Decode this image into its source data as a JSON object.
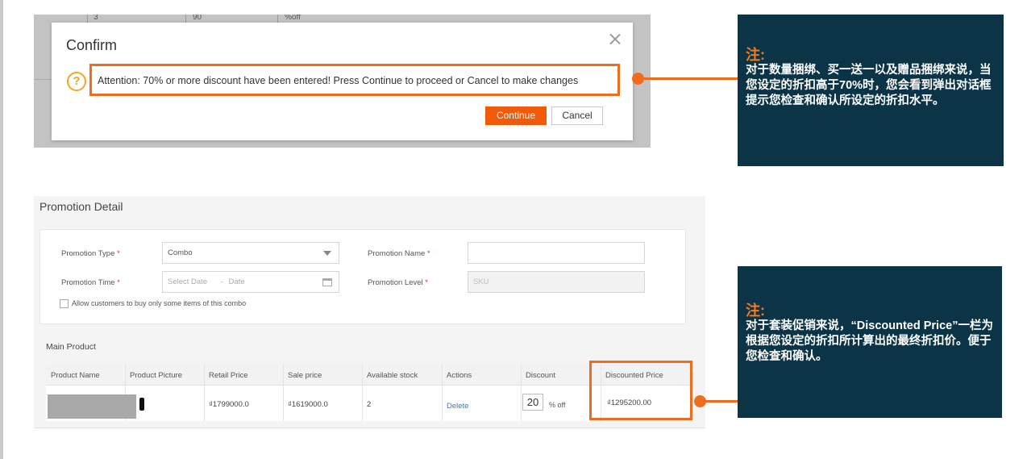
{
  "confirm_shot": {
    "background_row": {
      "qty": "3",
      "value": "90",
      "unit": "%off"
    },
    "dialog": {
      "title": "Confirm",
      "message": "Attention: 70% or more discount have been entered! Press Continue to proceed or Cancel to make changes",
      "warning_glyph": "?",
      "continue_label": "Continue",
      "cancel_label": "Cancel"
    }
  },
  "note1": {
    "title": "注:",
    "body": "对于数量捆绑、买一送一以及赠品捆绑来说，当您设定的折扣高于70%时，您会看到弹出对话框提示您检查和确认所设定的折扣水平。"
  },
  "note2": {
    "title": "注:",
    "body": "对于套装促销来说，“Discounted Price”一栏为根据您设定的折扣所计算出的最终折扣价。便于您检查和确认。"
  },
  "promotion_detail": {
    "title": "Promotion Detail",
    "form": {
      "type_label": "Promotion Type",
      "type_value": "Combo",
      "name_label": "Promotion Name",
      "name_value": "",
      "time_label": "Promotion Time",
      "time_start_placeholder": "Select Date",
      "time_separator": "-",
      "time_end_placeholder": "Date",
      "level_label": "Promotion Level",
      "level_value": "SKU",
      "required_mark": "*",
      "checkbox_label": "Allow customers to buy only some items of this combo"
    },
    "main_product_label": "Main Product",
    "table": {
      "headers": [
        "Product Name",
        "Product Picture",
        "Retail Price",
        "Sale price",
        "Available stock",
        "Actions",
        "Discount",
        "Discounted Price"
      ],
      "row": {
        "retail_price": "₫1799000.0",
        "sale_price": "₫1619000.0",
        "stock": "2",
        "action": "Delete",
        "discount": "20",
        "discount_unit": "% off",
        "discounted_price": "₫1295200.00"
      }
    }
  },
  "colors": {
    "accent": "#ef6c1e",
    "note_bg": "#0b3446",
    "button_primary": "#f05a0a",
    "link": "#2f7ad1"
  },
  "icons": [
    "close-icon",
    "warning-icon",
    "caret-down-icon",
    "calendar-icon"
  ]
}
